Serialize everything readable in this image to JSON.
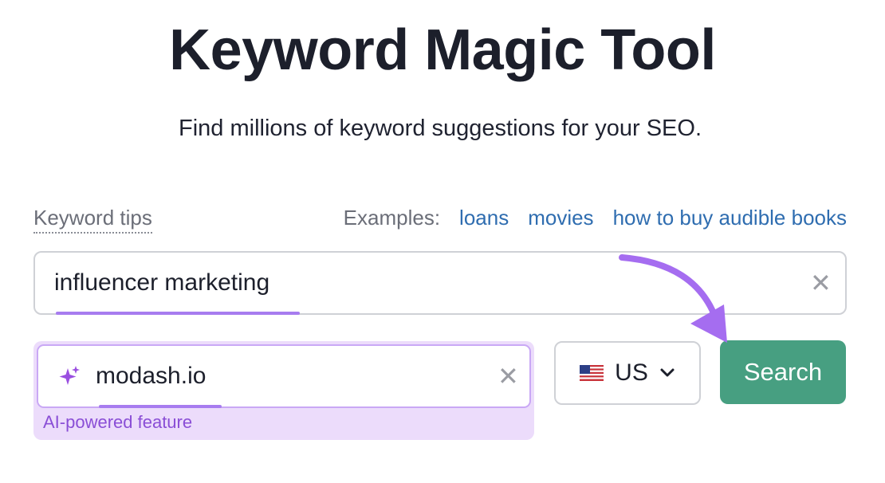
{
  "page": {
    "title": "Keyword Magic Tool",
    "subtitle": "Find millions of keyword suggestions for your SEO."
  },
  "tips": {
    "label": "Keyword tips"
  },
  "examples": {
    "label": "Examples:",
    "links": [
      "loans",
      "movies",
      "how to buy audible books"
    ]
  },
  "keyword_input": {
    "value": "influencer marketing",
    "clear_glyph": "✕"
  },
  "domain_input": {
    "value": "modash.io",
    "clear_glyph": "✕",
    "ai_label": "AI-powered feature"
  },
  "country_select": {
    "value": "US"
  },
  "search_button": {
    "label": "Search"
  },
  "colors": {
    "accent_purple": "#a77cef",
    "ai_background": "#ecdcfb",
    "search_green": "#479f81",
    "link_blue": "#2f6db0"
  },
  "icons": [
    "sparkle-icon",
    "us-flag-icon",
    "chevron-down-icon",
    "clear-icon",
    "arrow-annotation"
  ]
}
